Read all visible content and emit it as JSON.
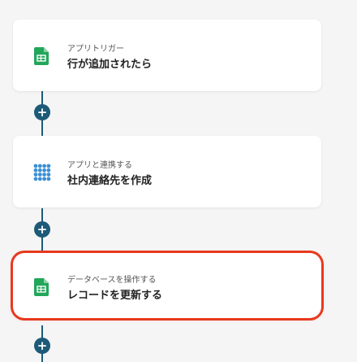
{
  "steps": [
    {
      "kind": "アプリトリガー",
      "title": "行が追加されたら",
      "icon": "google-sheets-icon"
    },
    {
      "kind": "アプリと連携する",
      "title": "社内連絡先を作成",
      "icon": "dot-grid-app-icon"
    },
    {
      "kind": "データベースを操作する",
      "title": "レコードを更新する",
      "icon": "google-sheets-icon"
    }
  ],
  "add_symbol": "+",
  "colors": {
    "background": "#f5f5f5",
    "connector": "#1d5a78",
    "selected_outline": "#e8391e",
    "sheets_green": "#22a65a",
    "app_blue": "#3b8fd6"
  }
}
